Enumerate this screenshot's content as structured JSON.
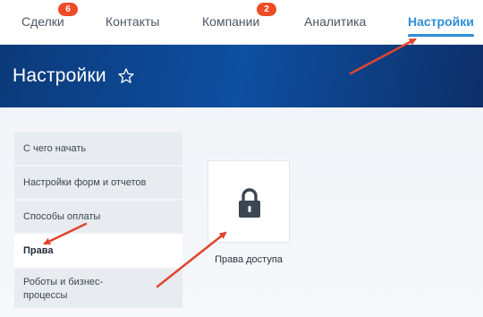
{
  "topnav": {
    "items": [
      {
        "label": "Сделки",
        "badge": "6"
      },
      {
        "label": "Контакты"
      },
      {
        "label": "Компании",
        "badge": "2"
      },
      {
        "label": "Аналитика"
      },
      {
        "label": "Настройки",
        "active": true
      }
    ]
  },
  "header": {
    "title": "Настройки",
    "favorite_icon": "star-outline-icon"
  },
  "sidebar": {
    "items": [
      {
        "label": "С чего начать"
      },
      {
        "label": "Настройки форм и отчетов"
      },
      {
        "label": "Способы оплаты"
      },
      {
        "label": "Права",
        "selected": true
      },
      {
        "label": "Роботы и бизнес-процессы"
      }
    ]
  },
  "main": {
    "tile": {
      "label": "Права доступа",
      "icon": "lock-icon"
    }
  },
  "colors": {
    "accent": "#2d8ed8",
    "badge": "#ef4b26",
    "header_bg": "#0e4fa1",
    "annotation_arrow": "#e0452e"
  }
}
